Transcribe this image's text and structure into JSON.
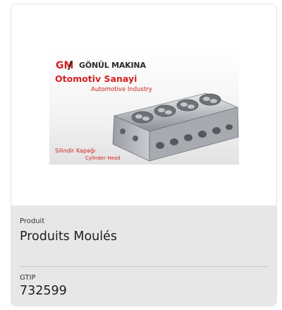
{
  "card": {
    "image": {
      "alt": "Cylinder Head",
      "brand": "GÖNÜL MAKINA",
      "logo_letters": "GM",
      "sector_tr": "Otomotiv Sanayi",
      "sector_en": "Automotive Industry",
      "part_tr": "Silindir Kapağı",
      "part_en": "Cylinder Head"
    },
    "product_label": "Produit",
    "product_value": "Produits Moulés",
    "gtip_label": "GTIP",
    "gtip_value": "732599"
  },
  "colors": {
    "brand_red": "#d42020",
    "info_bg": "#e7e7e7",
    "card_border": "#e4e4e4"
  }
}
